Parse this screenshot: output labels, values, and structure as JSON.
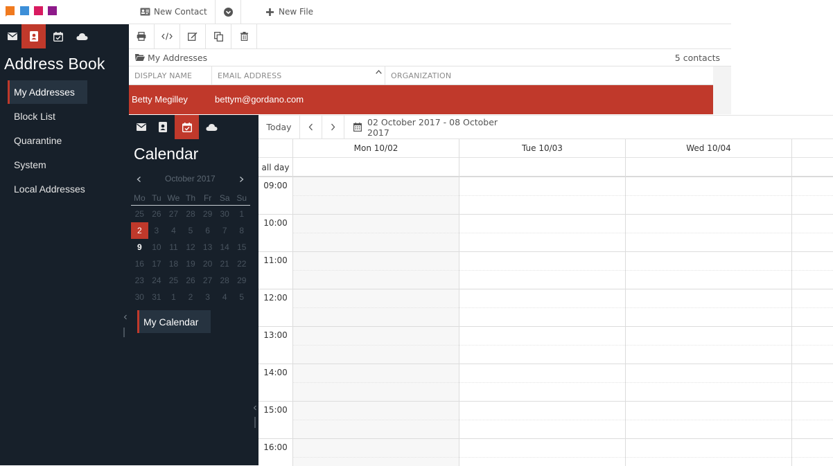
{
  "colors": {
    "sidebar_bg": "#17202a",
    "accent": "#c0392b",
    "logo": [
      "#f07a1f",
      "#3d8fd8",
      "#d81b60",
      "#8e1a8a"
    ]
  },
  "topbar": {
    "new_contact_label": "New Contact",
    "new_file_label": "New File"
  },
  "address_book": {
    "title": "Address Book",
    "nav": [
      {
        "label": "My Addresses",
        "active": true
      },
      {
        "label": "Block List",
        "active": false
      },
      {
        "label": "Quarantine",
        "active": false
      },
      {
        "label": "System",
        "active": false
      },
      {
        "label": "Local Addresses",
        "active": false
      }
    ],
    "folder_name": "My Addresses",
    "contact_count": "5 contacts",
    "columns": [
      "DISPLAY NAME",
      "EMAIL ADDRESS",
      "ORGANIZATION"
    ],
    "rows": [
      {
        "display_name": "Betty Megilley",
        "email": "bettym@gordano.com",
        "organization": ""
      }
    ]
  },
  "calendar": {
    "title": "Calendar",
    "mini_month": "October 2017",
    "weekdays": [
      "Mo",
      "Tu",
      "We",
      "Th",
      "Fr",
      "Sa",
      "Su"
    ],
    "weeks": [
      [
        "25",
        "26",
        "27",
        "28",
        "29",
        "30",
        "1"
      ],
      [
        "2",
        "3",
        "4",
        "5",
        "6",
        "7",
        "8"
      ],
      [
        "9",
        "10",
        "11",
        "12",
        "13",
        "14",
        "15"
      ],
      [
        "16",
        "17",
        "18",
        "19",
        "20",
        "21",
        "22"
      ],
      [
        "23",
        "24",
        "25",
        "26",
        "27",
        "28",
        "29"
      ],
      [
        "30",
        "31",
        "1",
        "2",
        "3",
        "4",
        "5"
      ]
    ],
    "selected_day": "2",
    "today_day": "9",
    "calendars": [
      {
        "label": "My Calendar"
      }
    ],
    "today_label": "Today",
    "date_range": "02 October 2017 - 08 October 2017",
    "day_headers": [
      "Mon 10/02",
      "Tue 10/03",
      "Wed 10/04"
    ],
    "all_day_label": "all day",
    "hours": [
      "09:00",
      "10:00",
      "11:00",
      "12:00",
      "13:00",
      "14:00",
      "15:00",
      "16:00"
    ]
  }
}
